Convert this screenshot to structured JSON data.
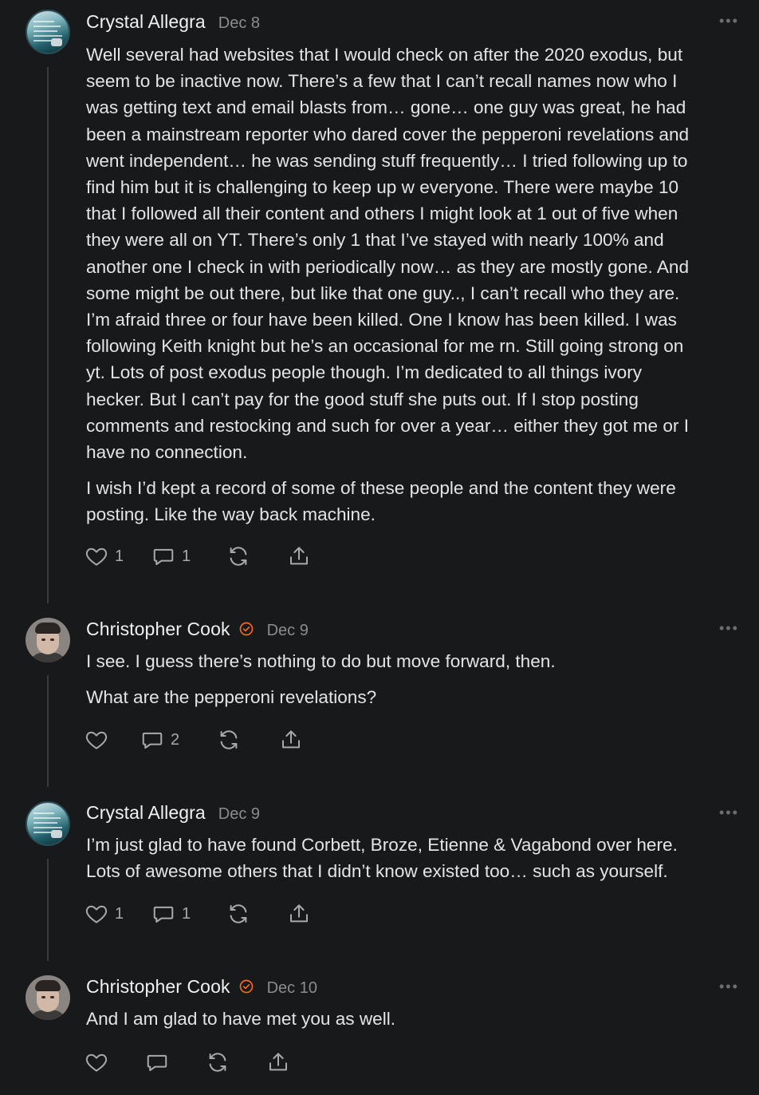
{
  "comments": [
    {
      "author": "Crystal Allegra",
      "date": "Dec 8",
      "verified": false,
      "paragraphs": [
        "Well several had websites that I would check on after the 2020 exodus, but\nseem to be inactive now. There’s a few that I can’t recall names now who I\nwas getting text and email blasts from… gone… one guy was great, he had\nbeen a mainstream reporter who dared cover the pepperoni revelations and\nwent independent… he was sending stuff frequently… I tried following up to\nfind him but it is challenging to keep up w everyone. There were maybe 10\nthat I followed all their content and others I might look at 1 out of five when\nthey were all on YT. There’s only 1 that I’ve stayed with nearly 100% and\nanother one I check in with periodically now… as they are mostly gone. And\nsome might be out there, but like that one guy.., I can’t recall who they are.\nI’m afraid three or four have been killed. One I know has been killed. I was\nfollowing Keith knight but he’s an occasional for me rn. Still going strong on\nyt. Lots of post exodus people though. I’m dedicated to all things ivory\nhecker. But I can’t pay for the good stuff she puts out. If I stop posting\ncomments and restocking and such for over a year… either they got me or I\nhave no connection.",
        "I wish I’d kept a record of some of these people and the content they were\nposting. Like the way back machine."
      ],
      "likes": "1",
      "replies": "1"
    },
    {
      "author": "Christopher Cook",
      "date": "Dec 9",
      "verified": true,
      "paragraphs": [
        "I see. I guess there’s nothing to do but move forward, then.",
        "What are the pepperoni revelations?"
      ],
      "likes": "",
      "replies": "2"
    },
    {
      "author": "Crystal Allegra",
      "date": "Dec 9",
      "verified": false,
      "paragraphs": [
        "I’m just glad to have found Corbett, Broze, Etienne & Vagabond over here.\nLots of awesome others that I didn’t know existed too… such as yourself."
      ],
      "likes": "1",
      "replies": "1"
    },
    {
      "author": "Christopher Cook",
      "date": "Dec 10",
      "verified": true,
      "paragraphs": [
        "And I am glad to have met you as well."
      ],
      "likes": "",
      "replies": ""
    }
  ],
  "more_menu_glyph": "•••",
  "icons": {
    "like": "heart-icon",
    "reply": "speech-bubble-icon",
    "restack": "restack-icon",
    "share": "share-icon",
    "verified": "verified-badge-icon"
  },
  "colors": {
    "background": "#18191b",
    "text": "#e4e4e6",
    "muted": "#8b8c90",
    "verified_accent": "#ff6719"
  }
}
